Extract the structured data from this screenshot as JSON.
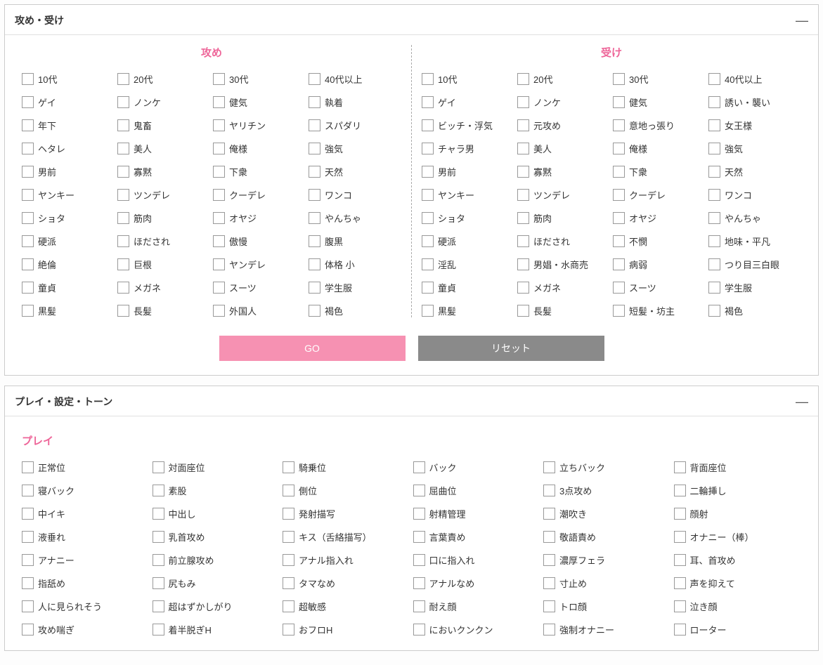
{
  "panel1": {
    "title": "攻め・受け",
    "col1_title": "攻め",
    "col2_title": "受け",
    "seme": [
      "10代",
      "20代",
      "30代",
      "40代以上",
      "ゲイ",
      "ノンケ",
      "健気",
      "執着",
      "年下",
      "鬼畜",
      "ヤリチン",
      "スパダリ",
      "ヘタレ",
      "美人",
      "俺様",
      "強気",
      "男前",
      "寡黙",
      "下衆",
      "天然",
      "ヤンキー",
      "ツンデレ",
      "クーデレ",
      "ワンコ",
      "ショタ",
      "筋肉",
      "オヤジ",
      "やんちゃ",
      "硬派",
      "ほだされ",
      "傲慢",
      "腹黒",
      "絶倫",
      "巨根",
      "ヤンデレ",
      "体格 小",
      "童貞",
      "メガネ",
      "スーツ",
      "学生服",
      "黒髪",
      "長髪",
      "外国人",
      "褐色"
    ],
    "uke": [
      "10代",
      "20代",
      "30代",
      "40代以上",
      "ゲイ",
      "ノンケ",
      "健気",
      "誘い・襲い",
      "ビッチ・浮気",
      "元攻め",
      "意地っ張り",
      "女王様",
      "チャラ男",
      "美人",
      "俺様",
      "強気",
      "男前",
      "寡黙",
      "下衆",
      "天然",
      "ヤンキー",
      "ツンデレ",
      "クーデレ",
      "ワンコ",
      "ショタ",
      "筋肉",
      "オヤジ",
      "やんちゃ",
      "硬派",
      "ほだされ",
      "不憫",
      "地味・平凡",
      "淫乱",
      "男娼・水商売",
      "病弱",
      "つり目三白眼",
      "童貞",
      "メガネ",
      "スーツ",
      "学生服",
      "黒髪",
      "長髪",
      "短髪・坊主",
      "褐色"
    ],
    "go_label": "GO",
    "reset_label": "リセット"
  },
  "panel2": {
    "title": "プレイ・設定・トーン",
    "section_title": "プレイ",
    "play": [
      "正常位",
      "対面座位",
      "騎乗位",
      "バック",
      "立ちバック",
      "背面座位",
      "寝バック",
      "素股",
      "側位",
      "屈曲位",
      "3点攻め",
      "二輪挿し",
      "中イキ",
      "中出し",
      "発射描写",
      "射精管理",
      "潮吹き",
      "顔射",
      "液垂れ",
      "乳首攻め",
      "キス（舌絡描写）",
      "言葉責め",
      "敬語責め",
      "オナニー（棒）",
      "アナニー",
      "前立腺攻め",
      "アナル指入れ",
      "口に指入れ",
      "濃厚フェラ",
      "耳、首攻め",
      "指舐め",
      "尻もみ",
      "タマなめ",
      "アナルなめ",
      "寸止め",
      "声を抑えて",
      "人に見られそう",
      "超はずかしがり",
      "超敏感",
      "耐え顔",
      "トロ顔",
      "泣き顔",
      "攻め喘ぎ",
      "着半脱ぎH",
      "おフロH",
      "においクンクン",
      "強制オナニー",
      "ローター"
    ]
  }
}
